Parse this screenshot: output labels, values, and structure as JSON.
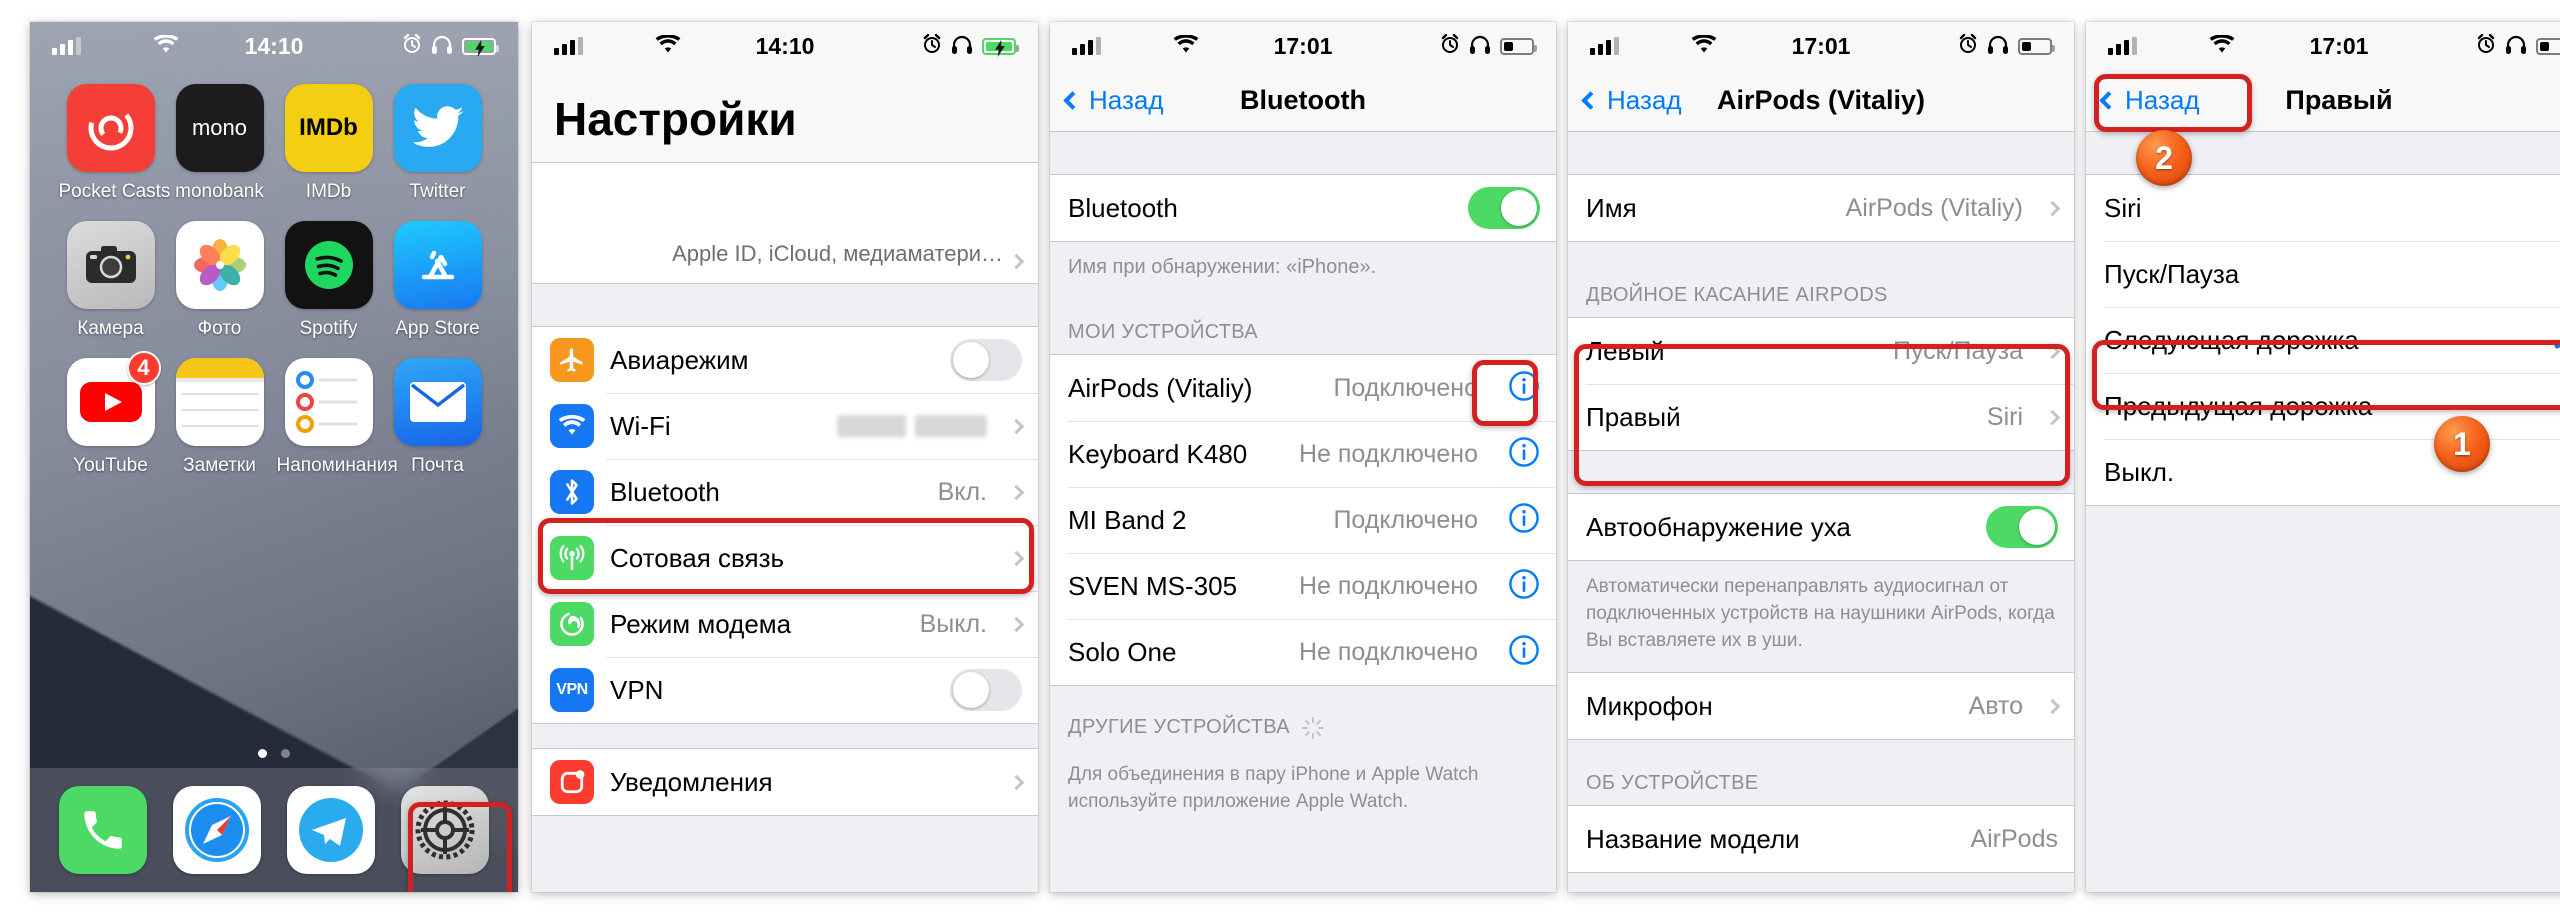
{
  "panels": {
    "home": {
      "statusbar": {
        "time": "14:10",
        "signal": "cellular-bars",
        "wifi": "wifi-icon",
        "alarm": "alarm-icon",
        "headphones": "headphones-icon",
        "battery": "battery-charging-icon"
      },
      "apps": [
        {
          "name": "Pocket Casts",
          "icon": "pocket-casts-icon",
          "badge": ""
        },
        {
          "name": "monobank",
          "icon": "monobank-icon",
          "badge": ""
        },
        {
          "name": "IMDb",
          "icon": "imdb-icon",
          "badge": ""
        },
        {
          "name": "Twitter",
          "icon": "twitter-icon",
          "badge": ""
        },
        {
          "name": "Камера",
          "icon": "camera-icon",
          "badge": ""
        },
        {
          "name": "Фото",
          "icon": "photos-icon",
          "badge": ""
        },
        {
          "name": "Spotify",
          "icon": "spotify-icon",
          "badge": ""
        },
        {
          "name": "App Store",
          "icon": "app-store-icon",
          "badge": ""
        },
        {
          "name": "YouTube",
          "icon": "youtube-icon",
          "badge": "4"
        },
        {
          "name": "Заметки",
          "icon": "notes-icon",
          "badge": ""
        },
        {
          "name": "Напоминания",
          "icon": "reminders-icon",
          "badge": ""
        },
        {
          "name": "Почта",
          "icon": "mail-icon",
          "badge": ""
        }
      ],
      "dock": [
        {
          "name": "Телефон",
          "icon": "phone-icon"
        },
        {
          "name": "Safari",
          "icon": "safari-icon"
        },
        {
          "name": "Telegram",
          "icon": "telegram-icon"
        },
        {
          "name": "Настройки",
          "icon": "settings-gear-icon"
        }
      ],
      "page_dots": 2,
      "active_dot": 1
    },
    "settings": {
      "statusbar": {
        "time": "14:10"
      },
      "title": "Настройки",
      "account_subtitle": "Apple ID, iCloud, медиаматери…",
      "rows": [
        {
          "label": "Авиарежим",
          "icon": "airplane-icon",
          "icon_color": "#f7971d",
          "control": "switch-off"
        },
        {
          "label": "Wi-Fi",
          "icon": "wifi-icon",
          "icon_color": "#1578f2",
          "control": "value-blurred",
          "value": ""
        },
        {
          "label": "Bluetooth",
          "icon": "bluetooth-icon",
          "icon_color": "#1578f2",
          "control": "value",
          "value": "Вкл."
        },
        {
          "label": "Сотовая связь",
          "icon": "cellular-icon",
          "icon_color": "#4cd964",
          "control": "value",
          "value": ""
        },
        {
          "label": "Режим модема",
          "icon": "hotspot-icon",
          "icon_color": "#4cd964",
          "control": "value",
          "value": "Выкл."
        },
        {
          "label": "VPN",
          "icon": "vpn-icon",
          "icon_color": "#1578f2",
          "control": "switch-off",
          "icon_text": "VPN"
        },
        {
          "label": "Уведомления",
          "icon": "notifications-icon",
          "icon_color": "#fc3a2d",
          "control": "value",
          "value": ""
        }
      ]
    },
    "bluetooth": {
      "statusbar": {
        "time": "17:01"
      },
      "back_label": "Назад",
      "title": "Bluetooth",
      "toggle_label": "Bluetooth",
      "toggle_state": "on",
      "discoverable_note": "Имя при обнаружении: «iPhone».",
      "my_devices_header": "МОИ УСТРОЙСТВА",
      "devices": [
        {
          "name": "AirPods (Vitaliy)",
          "status": "Подключено",
          "info": "info-icon"
        },
        {
          "name": "Keyboard K480",
          "status": "Не подключено",
          "info": "info-icon"
        },
        {
          "name": "MI Band 2",
          "status": "Подключено",
          "info": "info-icon"
        },
        {
          "name": "SVEN MS-305",
          "status": "Не подключено",
          "info": "info-icon"
        },
        {
          "name": "Solo One",
          "status": "Не подключено",
          "info": "info-icon"
        }
      ],
      "other_devices_header": "ДРУГИЕ УСТРОЙСТВА",
      "watch_note_part1": "Для объединения в пару iPhone и Apple Watch используйте ",
      "watch_note_link": "приложение Apple Watch",
      "watch_note_part2": "."
    },
    "airpods": {
      "statusbar": {
        "time": "17:01"
      },
      "back_label": "Назад",
      "title": "AirPods (Vitaliy)",
      "name_row": {
        "label": "Имя",
        "value": "AirPods (Vitaliy)"
      },
      "double_tap_header": "ДВОЙНОЕ КАСАНИЕ AIRPODS",
      "left_row": {
        "label": "Левый",
        "value": "Пуск/Пауза"
      },
      "right_row": {
        "label": "Правый",
        "value": "Siri"
      },
      "ear_detect": {
        "label": "Автообнаружение уха",
        "state": "on"
      },
      "ear_detect_note": "Автоматически перенаправлять аудиосигнал от подключенных устройств на наушники AirPods, когда Вы вставляете их в уши.",
      "mic_row": {
        "label": "Микрофон",
        "value": "Авто"
      },
      "about_header": "ОБ УСТРОЙСТВЕ",
      "model_row": {
        "label": "Название модели",
        "value": "AirPods"
      }
    },
    "right_pod": {
      "statusbar": {
        "time": "17:01"
      },
      "back_label": "Назад",
      "title": "Правый",
      "options": [
        {
          "label": "Siri",
          "selected": false
        },
        {
          "label": "Пуск/Пауза",
          "selected": false
        },
        {
          "label": "Следующая дорожка",
          "selected": true
        },
        {
          "label": "Предыдущая дорожка",
          "selected": false
        },
        {
          "label": "Выкл.",
          "selected": false
        }
      ]
    }
  },
  "annotations": {
    "step_one": "1",
    "step_two": "2",
    "highlight_color": "#d32020"
  }
}
